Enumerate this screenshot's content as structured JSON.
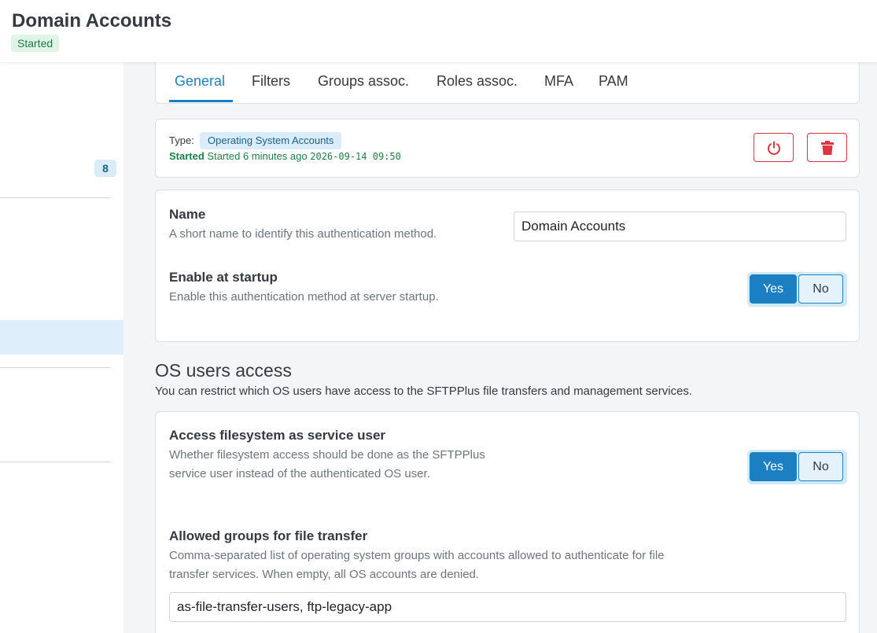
{
  "header": {
    "title": "Domain Accounts",
    "status": "Started"
  },
  "sidebar": {
    "badge_count": "8"
  },
  "tabs": [
    {
      "label": "General",
      "active": true
    },
    {
      "label": "Filters",
      "active": false
    },
    {
      "label": "Groups assoc.",
      "active": false
    },
    {
      "label": "Roles assoc.",
      "active": false
    },
    {
      "label": "MFA",
      "active": false
    },
    {
      "label": "PAM",
      "active": false
    }
  ],
  "summary": {
    "type_label": "Type:",
    "type_value": "Operating System Accounts",
    "state": "Started",
    "state_detail": "Started 6 minutes ago",
    "timestamp": "2026-09-14 09:50",
    "power_icon": "power-icon",
    "delete_icon": "trash-icon"
  },
  "general": {
    "name": {
      "title": "Name",
      "help": "A short name to identify this authentication method.",
      "value": "Domain Accounts"
    },
    "enable_at_startup": {
      "title": "Enable at startup",
      "help": "Enable this authentication method at server startup.",
      "yes_label": "Yes",
      "no_label": "No",
      "selected": "Yes"
    }
  },
  "os_access": {
    "title": "OS users access",
    "description": "You can restrict which OS users have access to the SFTPPlus file transfers and management services.",
    "service_user": {
      "title": "Access filesystem as service user",
      "help": "Whether filesystem access should be done as the SFTPPlus service user instead of the authenticated OS user.",
      "yes_label": "Yes",
      "no_label": "No",
      "selected": "Yes"
    },
    "allowed_groups": {
      "title": "Allowed groups for file transfer",
      "help": "Comma-separated list of operating system groups with accounts allowed to authenticate for file transfer services. When empty, all OS accounts are denied.",
      "value": "as-file-transfer-users, ftp-legacy-app"
    }
  },
  "colors": {
    "accent": "#1c7fc2",
    "success": "#1e7e45",
    "danger": "#dc3545"
  }
}
